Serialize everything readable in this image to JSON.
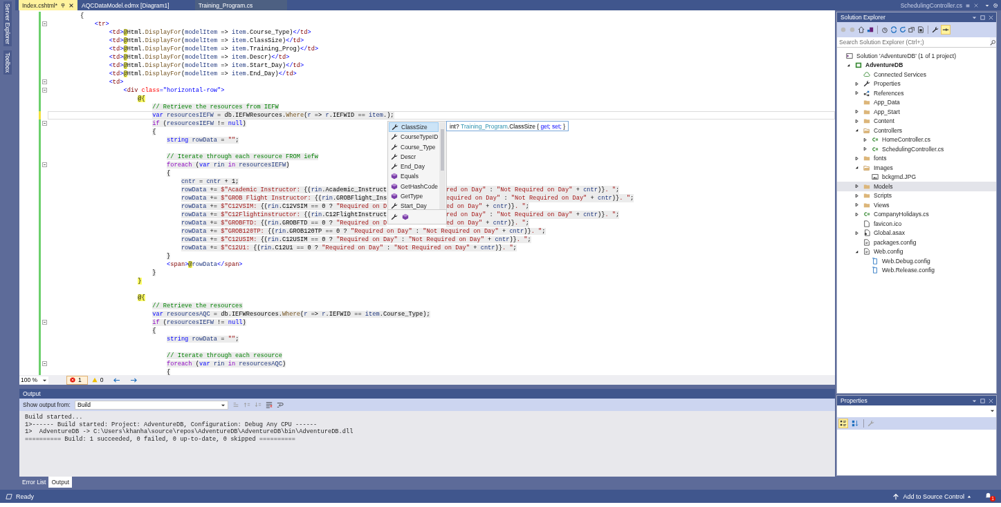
{
  "side_tabs": [
    "Server Explorer",
    "Toolbox"
  ],
  "tabs": [
    {
      "label": "Index.cshtml*",
      "selected": true
    },
    {
      "label": "AQCDataModel.edmx [Diagram1]",
      "selected": false
    },
    {
      "label": "Training_Program.cs",
      "selected": false
    }
  ],
  "preview_tab": {
    "label": "SchedulingController.cs"
  },
  "editor": {
    "lines": [
      {
        "tokens": [
          {
            "kind": "plain",
            "text": "        {"
          }
        ],
        "shaded": false,
        "fold": false,
        "current": false
      },
      {
        "tokens": [
          {
            "kind": "bracket",
            "text": "            <"
          },
          {
            "kind": "tag",
            "text": "tr"
          },
          {
            "kind": "bracket",
            "text": ">"
          }
        ],
        "shaded": false,
        "fold": true,
        "current": false
      },
      {
        "tokens": [
          {
            "kind": "bracket",
            "text": "                <"
          },
          {
            "kind": "tag",
            "text": "td"
          },
          {
            "kind": "bracket",
            "text": ">"
          },
          {
            "kind": "razor",
            "text": "@"
          },
          {
            "kind": "plain",
            "text": "Html."
          },
          {
            "kind": "method",
            "text": "DisplayFor"
          },
          {
            "kind": "plain",
            "text": "("
          },
          {
            "kind": "local",
            "text": "modelItem"
          },
          {
            "kind": "plain",
            "text": " => "
          },
          {
            "kind": "local",
            "text": "item"
          },
          {
            "kind": "plain",
            "text": ".Course_Type)"
          },
          {
            "kind": "bracket",
            "text": "</"
          },
          {
            "kind": "tag",
            "text": "td"
          },
          {
            "kind": "bracket",
            "text": ">"
          }
        ],
        "shaded": false,
        "fold": false,
        "current": false
      },
      {
        "tokens": [
          {
            "kind": "bracket",
            "text": "                <"
          },
          {
            "kind": "tag",
            "text": "td"
          },
          {
            "kind": "bracket",
            "text": ">"
          },
          {
            "kind": "razor",
            "text": "@"
          },
          {
            "kind": "plain",
            "text": "Html."
          },
          {
            "kind": "method",
            "text": "DisplayFor"
          },
          {
            "kind": "plain",
            "text": "("
          },
          {
            "kind": "local",
            "text": "modelItem"
          },
          {
            "kind": "plain",
            "text": " => "
          },
          {
            "kind": "local",
            "text": "item"
          },
          {
            "kind": "plain",
            "text": ".ClassSize)"
          },
          {
            "kind": "bracket",
            "text": "</"
          },
          {
            "kind": "tag",
            "text": "td"
          },
          {
            "kind": "bracket",
            "text": ">"
          }
        ],
        "shaded": false,
        "fold": false,
        "current": false
      },
      {
        "tokens": [
          {
            "kind": "bracket",
            "text": "                <"
          },
          {
            "kind": "tag",
            "text": "td"
          },
          {
            "kind": "bracket",
            "text": ">"
          },
          {
            "kind": "razor",
            "text": "@"
          },
          {
            "kind": "plain",
            "text": "Html."
          },
          {
            "kind": "method",
            "text": "DisplayFor"
          },
          {
            "kind": "plain",
            "text": "("
          },
          {
            "kind": "local",
            "text": "modelItem"
          },
          {
            "kind": "plain",
            "text": " => "
          },
          {
            "kind": "local",
            "text": "item"
          },
          {
            "kind": "plain",
            "text": ".Training_Prog)"
          },
          {
            "kind": "bracket",
            "text": "</"
          },
          {
            "kind": "tag",
            "text": "td"
          },
          {
            "kind": "bracket",
            "text": ">"
          }
        ],
        "shaded": false,
        "fold": false,
        "current": false
      },
      {
        "tokens": [
          {
            "kind": "bracket",
            "text": "                <"
          },
          {
            "kind": "tag",
            "text": "td"
          },
          {
            "kind": "bracket",
            "text": ">"
          },
          {
            "kind": "razor",
            "text": "@"
          },
          {
            "kind": "plain",
            "text": "Html."
          },
          {
            "kind": "method",
            "text": "DisplayFor"
          },
          {
            "kind": "plain",
            "text": "("
          },
          {
            "kind": "local",
            "text": "modelItem"
          },
          {
            "kind": "plain",
            "text": " => "
          },
          {
            "kind": "local",
            "text": "item"
          },
          {
            "kind": "plain",
            "text": ".Descr)"
          },
          {
            "kind": "bracket",
            "text": "</"
          },
          {
            "kind": "tag",
            "text": "td"
          },
          {
            "kind": "bracket",
            "text": ">"
          }
        ],
        "shaded": false,
        "fold": false,
        "current": false
      },
      {
        "tokens": [
          {
            "kind": "bracket",
            "text": "                <"
          },
          {
            "kind": "tag",
            "text": "td"
          },
          {
            "kind": "bracket",
            "text": ">"
          },
          {
            "kind": "razor",
            "text": "@"
          },
          {
            "kind": "plain",
            "text": "Html."
          },
          {
            "kind": "method",
            "text": "DisplayFor"
          },
          {
            "kind": "plain",
            "text": "("
          },
          {
            "kind": "local",
            "text": "modelItem"
          },
          {
            "kind": "plain",
            "text": " => "
          },
          {
            "kind": "local",
            "text": "item"
          },
          {
            "kind": "plain",
            "text": ".Start_Day)"
          },
          {
            "kind": "bracket",
            "text": "</"
          },
          {
            "kind": "tag",
            "text": "td"
          },
          {
            "kind": "bracket",
            "text": ">"
          }
        ],
        "shaded": false,
        "fold": false,
        "current": false
      },
      {
        "tokens": [
          {
            "kind": "bracket",
            "text": "                <"
          },
          {
            "kind": "tag",
            "text": "td"
          },
          {
            "kind": "bracket",
            "text": ">"
          },
          {
            "kind": "razor",
            "text": "@"
          },
          {
            "kind": "plain",
            "text": "Html."
          },
          {
            "kind": "method",
            "text": "DisplayFor"
          },
          {
            "kind": "plain",
            "text": "("
          },
          {
            "kind": "local",
            "text": "modelItem"
          },
          {
            "kind": "plain",
            "text": " => "
          },
          {
            "kind": "local",
            "text": "item"
          },
          {
            "kind": "plain",
            "text": ".End_Day)"
          },
          {
            "kind": "bracket",
            "text": "</"
          },
          {
            "kind": "tag",
            "text": "td"
          },
          {
            "kind": "bracket",
            "text": ">"
          }
        ],
        "shaded": false,
        "fold": false,
        "current": false
      },
      {
        "tokens": [
          {
            "kind": "bracket",
            "text": "                <"
          },
          {
            "kind": "tag",
            "text": "td"
          },
          {
            "kind": "bracket",
            "text": ">"
          }
        ],
        "shaded": false,
        "fold": true,
        "current": false
      },
      {
        "tokens": [
          {
            "kind": "bracket",
            "text": "                    <"
          },
          {
            "kind": "tag",
            "text": "div"
          },
          {
            "kind": "attr",
            "text": " class"
          },
          {
            "kind": "bracket",
            "text": "=\"horizontal-row\">"
          }
        ],
        "shaded": false,
        "fold": true,
        "current": false
      },
      {
        "tokens": [
          {
            "kind": "razor",
            "text": "                        @{"
          }
        ],
        "shaded": false,
        "fold": false,
        "current": false
      },
      {
        "tokens": [
          {
            "kind": "comment",
            "text": "                            // Retrieve the resources from IEFW"
          }
        ],
        "shaded": true,
        "fold": false,
        "current": false
      },
      {
        "tokens": [
          {
            "kind": "keyword",
            "text": "                            var"
          },
          {
            "kind": "local",
            "text": " resourcesIEFW"
          },
          {
            "kind": "plain",
            "text": " = db.IEFWResources."
          },
          {
            "kind": "method",
            "text": "Where"
          },
          {
            "kind": "plain",
            "text": "("
          },
          {
            "kind": "local",
            "text": "r"
          },
          {
            "kind": "plain",
            "text": " => "
          },
          {
            "kind": "local",
            "text": "r"
          },
          {
            "kind": "plain",
            "text": ".IEFWID == "
          },
          {
            "kind": "local",
            "text": "item"
          },
          {
            "kind": "plain",
            "text": ".);"
          }
        ],
        "shaded": true,
        "fold": false,
        "current": true
      },
      {
        "tokens": [
          {
            "kind": "control",
            "text": "                            if"
          },
          {
            "kind": "plain",
            "text": " ("
          },
          {
            "kind": "local",
            "text": "resourcesIEFW"
          },
          {
            "kind": "plain",
            "text": " != "
          },
          {
            "kind": "keyword",
            "text": "null"
          },
          {
            "kind": "plain",
            "text": ")"
          }
        ],
        "shaded": true,
        "fold": true,
        "current": false
      },
      {
        "tokens": [
          {
            "kind": "plain",
            "text": "                            {"
          }
        ],
        "shaded": true,
        "fold": false,
        "current": false
      },
      {
        "tokens": [
          {
            "kind": "keyword",
            "text": "                                string"
          },
          {
            "kind": "local",
            "text": " rowData"
          },
          {
            "kind": "plain",
            "text": " = "
          },
          {
            "kind": "string",
            "text": "\"\""
          },
          {
            "kind": "plain",
            "text": ";"
          }
        ],
        "shaded": true,
        "fold": false,
        "current": false
      },
      {
        "fold": false,
        "current": false
      },
      {
        "tokens": [
          {
            "kind": "comment",
            "text": "                                // Iterate through each resource FROM iefw"
          }
        ],
        "shaded": true,
        "fold": false,
        "current": false
      },
      {
        "tokens": [
          {
            "kind": "control",
            "text": "                                foreach"
          },
          {
            "kind": "plain",
            "text": " ("
          },
          {
            "kind": "keyword",
            "text": "var"
          },
          {
            "kind": "local",
            "text": " rin"
          },
          {
            "kind": "control",
            "text": " in"
          },
          {
            "kind": "local",
            "text": " resourcesIEFW"
          },
          {
            "kind": "plain",
            "text": ")"
          }
        ],
        "shaded": true,
        "fold": true,
        "current": false
      },
      {
        "tokens": [
          {
            "kind": "plain",
            "text": "                                {"
          }
        ],
        "shaded": true,
        "fold": false,
        "current": false
      },
      {
        "tokens": [
          {
            "kind": "local",
            "text": "                                    cntr"
          },
          {
            "kind": "plain",
            "text": " = "
          },
          {
            "kind": "local",
            "text": "cntr"
          },
          {
            "kind": "plain",
            "text": " + 1;"
          }
        ],
        "shaded": true,
        "fold": false,
        "current": false
      },
      {
        "tokens": [
          {
            "kind": "local",
            "text": "                                    rowData"
          },
          {
            "kind": "plain",
            "text": " += "
          },
          {
            "kind": "string",
            "text": "$\"Academic Instructor: "
          },
          {
            "kind": "plain",
            "text": "{("
          },
          {
            "kind": "local",
            "text": "rin"
          },
          {
            "kind": "plain",
            "text": ".Academic_Instruct"
          }
        ],
        "tokens_after": [
          {
            "kind": "string",
            "text": "red on Day\""
          },
          {
            "kind": "plain",
            "text": " : "
          },
          {
            "kind": "string",
            "text": "\"Not Required on Day\""
          },
          {
            "kind": "plain",
            "text": " + "
          },
          {
            "kind": "local",
            "text": "cntr"
          },
          {
            "kind": "plain",
            "text": ")}"
          },
          {
            "kind": "string",
            "text": ". \""
          },
          {
            "kind": "plain",
            "text": ";"
          }
        ],
        "shaded": true,
        "fold": false,
        "current": false
      },
      {
        "tokens": [
          {
            "kind": "local",
            "text": "                                    rowData"
          },
          {
            "kind": "plain",
            "text": " += "
          },
          {
            "kind": "string",
            "text": "$\"GROB Flight Instructor: "
          },
          {
            "kind": "plain",
            "text": "{("
          },
          {
            "kind": "local",
            "text": "rin"
          },
          {
            "kind": "plain",
            "text": ".GROBFlight_Ins"
          }
        ],
        "tokens_after": [
          {
            "kind": "string",
            "text": "equired on Day\""
          },
          {
            "kind": "plain",
            "text": " : "
          },
          {
            "kind": "string",
            "text": "\"Not Required on Day\""
          },
          {
            "kind": "plain",
            "text": " + "
          },
          {
            "kind": "local",
            "text": "cntr"
          },
          {
            "kind": "plain",
            "text": ")}"
          },
          {
            "kind": "string",
            "text": ". \""
          },
          {
            "kind": "plain",
            "text": ";"
          }
        ],
        "shaded": true,
        "fold": false,
        "current": false
      },
      {
        "tokens": [
          {
            "kind": "local",
            "text": "                                    rowData"
          },
          {
            "kind": "plain",
            "text": " += "
          },
          {
            "kind": "string",
            "text": "$\"C12VSIM: "
          },
          {
            "kind": "plain",
            "text": "{("
          },
          {
            "kind": "local",
            "text": "rin"
          },
          {
            "kind": "plain",
            "text": ".C12VSIM == 0 ? "
          },
          {
            "kind": "string",
            "text": "\"Required on D"
          }
        ],
        "tokens_after": [
          {
            "kind": "string",
            "text": "ed on Day\""
          },
          {
            "kind": "plain",
            "text": " + "
          },
          {
            "kind": "local",
            "text": "cntr"
          },
          {
            "kind": "plain",
            "text": ")}"
          },
          {
            "kind": "string",
            "text": ". \""
          },
          {
            "kind": "plain",
            "text": ";"
          }
        ],
        "shaded": true,
        "fold": false,
        "current": false
      },
      {
        "tokens": [
          {
            "kind": "local",
            "text": "                                    rowData"
          },
          {
            "kind": "plain",
            "text": " += "
          },
          {
            "kind": "string",
            "text": "$\"C12Flightinstructor: "
          },
          {
            "kind": "plain",
            "text": "{("
          },
          {
            "kind": "local",
            "text": "rin"
          },
          {
            "kind": "plain",
            "text": ".C12FlightInstruct"
          }
        ],
        "tokens_after": [
          {
            "kind": "string",
            "text": "red on Day\""
          },
          {
            "kind": "plain",
            "text": " : "
          },
          {
            "kind": "string",
            "text": "\"Not Required on Day\""
          },
          {
            "kind": "plain",
            "text": " + "
          },
          {
            "kind": "local",
            "text": "cntr"
          },
          {
            "kind": "plain",
            "text": ")}"
          },
          {
            "kind": "string",
            "text": ". \""
          },
          {
            "kind": "plain",
            "text": ";"
          }
        ],
        "shaded": true,
        "fold": false,
        "current": false
      },
      {
        "tokens": [
          {
            "kind": "local",
            "text": "                                    rowData"
          },
          {
            "kind": "plain",
            "text": " += "
          },
          {
            "kind": "string",
            "text": "$\"GROBFTD: "
          },
          {
            "kind": "plain",
            "text": "{("
          },
          {
            "kind": "local",
            "text": "rin"
          },
          {
            "kind": "plain",
            "text": ".GROBFTD == 0 ? "
          },
          {
            "kind": "string",
            "text": "\"Required on D"
          }
        ],
        "tokens_after": [
          {
            "kind": "string",
            "text": "ed on Day\""
          },
          {
            "kind": "plain",
            "text": " + "
          },
          {
            "kind": "local",
            "text": "cntr"
          },
          {
            "kind": "plain",
            "text": ")}"
          },
          {
            "kind": "string",
            "text": ". \""
          },
          {
            "kind": "plain",
            "text": ";"
          }
        ],
        "shaded": true,
        "fold": false,
        "current": false
      },
      {
        "tokens": [
          {
            "kind": "local",
            "text": "                                    rowData"
          },
          {
            "kind": "plain",
            "text": " += "
          },
          {
            "kind": "string",
            "text": "$\"GROB120TP: "
          },
          {
            "kind": "plain",
            "text": "{("
          },
          {
            "kind": "local",
            "text": "rin"
          },
          {
            "kind": "plain",
            "text": ".GROB120TP == 0 ? "
          },
          {
            "kind": "string",
            "text": "\"Required on Day\""
          },
          {
            "kind": "plain",
            "text": " : "
          },
          {
            "kind": "string",
            "text": "\"Not Required on Day\""
          },
          {
            "kind": "plain",
            "text": " + "
          },
          {
            "kind": "local",
            "text": "cntr"
          },
          {
            "kind": "plain",
            "text": ")}"
          },
          {
            "kind": "string",
            "text": ". \""
          },
          {
            "kind": "plain",
            "text": ";"
          }
        ],
        "shaded": true,
        "fold": false,
        "current": false
      },
      {
        "tokens": [
          {
            "kind": "local",
            "text": "                                    rowData"
          },
          {
            "kind": "plain",
            "text": " += "
          },
          {
            "kind": "string",
            "text": "$\"C12USIM: "
          },
          {
            "kind": "plain",
            "text": "{("
          },
          {
            "kind": "local",
            "text": "rin"
          },
          {
            "kind": "plain",
            "text": ".C12USIM == 0 ? "
          },
          {
            "kind": "string",
            "text": "\"Required on Day\""
          },
          {
            "kind": "plain",
            "text": " : "
          },
          {
            "kind": "string",
            "text": "\"Not Required on Day\""
          },
          {
            "kind": "plain",
            "text": " + "
          },
          {
            "kind": "local",
            "text": "cntr"
          },
          {
            "kind": "plain",
            "text": ")}"
          },
          {
            "kind": "string",
            "text": ". \""
          },
          {
            "kind": "plain",
            "text": ";"
          }
        ],
        "shaded": true,
        "fold": false,
        "current": false
      },
      {
        "tokens": [
          {
            "kind": "local",
            "text": "                                    rowData"
          },
          {
            "kind": "plain",
            "text": " += "
          },
          {
            "kind": "string",
            "text": "$\"C12U1: "
          },
          {
            "kind": "plain",
            "text": "{("
          },
          {
            "kind": "local",
            "text": "rin"
          },
          {
            "kind": "plain",
            "text": ".C12U1 == 0 ? "
          },
          {
            "kind": "string",
            "text": "\"Required on Day\""
          },
          {
            "kind": "plain",
            "text": " : "
          },
          {
            "kind": "string",
            "text": "\"Not Required on Day\""
          },
          {
            "kind": "plain",
            "text": " + "
          },
          {
            "kind": "local",
            "text": "cntr"
          },
          {
            "kind": "plain",
            "text": ")}"
          },
          {
            "kind": "string",
            "text": ". \""
          },
          {
            "kind": "plain",
            "text": ";"
          }
        ],
        "shaded": true,
        "fold": false,
        "current": false
      },
      {
        "tokens": [
          {
            "kind": "plain",
            "text": "                                }"
          }
        ],
        "shaded": true,
        "fold": false,
        "current": false
      },
      {
        "tokens": [
          {
            "kind": "bracket",
            "text": "                                <"
          },
          {
            "kind": "tag",
            "text": "span"
          },
          {
            "kind": "bracket",
            "text": ">"
          },
          {
            "kind": "razor",
            "text": "@"
          },
          {
            "kind": "local",
            "text": "rowData"
          },
          {
            "kind": "bracket",
            "text": "</"
          },
          {
            "kind": "tag",
            "text": "span"
          },
          {
            "kind": "bracket",
            "text": ">"
          }
        ],
        "shaded": false,
        "fold": false,
        "current": false
      },
      {
        "tokens": [
          {
            "kind": "plain",
            "text": "                            }"
          }
        ],
        "shaded": true,
        "fold": false,
        "current": false
      },
      {
        "tokens": [
          {
            "kind": "razor",
            "text": "                        }"
          }
        ],
        "shaded": false,
        "fold": false,
        "current": false
      },
      {
        "fold": false,
        "current": false
      },
      {
        "tokens": [
          {
            "kind": "razor",
            "text": "                        @{"
          }
        ],
        "shaded": false,
        "fold": false,
        "current": false
      },
      {
        "tokens": [
          {
            "kind": "comment",
            "text": "                            // Retrieve the resources"
          }
        ],
        "shaded": true,
        "fold": false,
        "current": false
      },
      {
        "tokens": [
          {
            "kind": "keyword",
            "text": "                            var"
          },
          {
            "kind": "local",
            "text": " resourcesAQC"
          },
          {
            "kind": "plain",
            "text": " = db.IEFWResources."
          },
          {
            "kind": "method",
            "text": "Where"
          },
          {
            "kind": "plain",
            "text": "("
          },
          {
            "kind": "local",
            "text": "r"
          },
          {
            "kind": "plain",
            "text": " => "
          },
          {
            "kind": "local",
            "text": "r"
          },
          {
            "kind": "plain",
            "text": ".IEFWID == "
          },
          {
            "kind": "local",
            "text": "item"
          },
          {
            "kind": "plain",
            "text": ".Course_Type);"
          }
        ],
        "shaded": true,
        "fold": false,
        "current": false
      },
      {
        "tokens": [
          {
            "kind": "control",
            "text": "                            if"
          },
          {
            "kind": "plain",
            "text": " ("
          },
          {
            "kind": "local",
            "text": "resourcesIEFW"
          },
          {
            "kind": "plain",
            "text": " != "
          },
          {
            "kind": "keyword",
            "text": "null"
          },
          {
            "kind": "plain",
            "text": ")"
          }
        ],
        "shaded": true,
        "fold": true,
        "current": false
      },
      {
        "tokens": [
          {
            "kind": "plain",
            "text": "                            {"
          }
        ],
        "shaded": true,
        "fold": false,
        "current": false
      },
      {
        "tokens": [
          {
            "kind": "keyword",
            "text": "                                string"
          },
          {
            "kind": "local",
            "text": " rowData"
          },
          {
            "kind": "plain",
            "text": " = "
          },
          {
            "kind": "string",
            "text": "\"\""
          },
          {
            "kind": "plain",
            "text": ";"
          }
        ],
        "shaded": true,
        "fold": false,
        "current": false
      },
      {
        "fold": false,
        "current": false
      },
      {
        "tokens": [
          {
            "kind": "comment",
            "text": "                                // Iterate through each resource"
          }
        ],
        "shaded": true,
        "fold": false,
        "current": false
      },
      {
        "tokens": [
          {
            "kind": "control",
            "text": "                                foreach"
          },
          {
            "kind": "plain",
            "text": " ("
          },
          {
            "kind": "keyword",
            "text": "var"
          },
          {
            "kind": "local",
            "text": " rin"
          },
          {
            "kind": "control",
            "text": " in"
          },
          {
            "kind": "local",
            "text": " resourcesAQC"
          },
          {
            "kind": "plain",
            "text": ")"
          }
        ],
        "shaded": true,
        "fold": true,
        "current": false
      },
      {
        "tokens": [
          {
            "kind": "plain",
            "text": "                                {"
          }
        ],
        "shaded": true,
        "fold": false,
        "current": false
      }
    ],
    "completion": {
      "items": [
        {
          "label": "ClassSize",
          "kind": "property",
          "selected": true
        },
        {
          "label": "CourseTypeID",
          "kind": "property",
          "selected": false
        },
        {
          "label": "Course_Type",
          "kind": "property",
          "selected": false
        },
        {
          "label": "Descr",
          "kind": "property",
          "selected": false
        },
        {
          "label": "End_Day",
          "kind": "property",
          "selected": false
        },
        {
          "label": "Equals",
          "kind": "method",
          "selected": false
        },
        {
          "label": "GetHashCode",
          "kind": "method",
          "selected": false
        },
        {
          "label": "GetType",
          "kind": "method",
          "selected": false
        },
        {
          "label": "Start_Day",
          "kind": "property",
          "selected": false
        }
      ],
      "tooltip": [
        {
          "kind": "plain",
          "text": "int? "
        },
        {
          "kind": "type",
          "text": "Training_Program"
        },
        {
          "kind": "plain",
          "text": ".ClassSize { "
        },
        {
          "kind": "keyword",
          "text": "get; set;"
        },
        {
          "kind": "plain",
          "text": " }"
        }
      ]
    },
    "zoom": "100 %",
    "errors": "1",
    "warnings": "0"
  },
  "output": {
    "title": "Output",
    "source_label": "Show output from:",
    "source": "Build",
    "lines": [
      "Build started...",
      "1>------ Build started: Project: AdventureDB, Configuration: Debug Any CPU ------",
      "1>  AdventureDB -> C:\\Users\\khanha\\source\\repos\\AdventureDB\\AdventureDB\\bin\\AdventureDB.dll",
      "========== Build: 1 succeeded, 0 failed, 0 up-to-date, 0 skipped =========="
    ]
  },
  "bottom_tabs": [
    {
      "label": "Error List",
      "selected": false
    },
    {
      "label": "Output",
      "selected": true
    }
  ],
  "solution_explorer": {
    "title": "Solution Explorer",
    "search_placeholder": "Search Solution Explorer (Ctrl+;)",
    "preview_on": true,
    "tree": [
      {
        "label": "Solution 'AdventureDB' (1 of 1 project)",
        "kind": "solution",
        "selected": false,
        "children": [
          {
            "label": "AdventureDB",
            "kind": "project",
            "expanded": true,
            "selected": false,
            "children": [
              {
                "label": "Connected Services",
                "kind": "service",
                "selected": false
              },
              {
                "label": "Properties",
                "kind": "properties",
                "expanded": false,
                "selected": false
              },
              {
                "label": "References",
                "kind": "references",
                "expanded": false,
                "selected": false
              },
              {
                "label": "App_Data",
                "kind": "folder",
                "selected": false
              },
              {
                "label": "App_Start",
                "kind": "folder",
                "expanded": false,
                "selected": false
              },
              {
                "label": "Content",
                "kind": "folder",
                "expanded": false,
                "selected": false
              },
              {
                "label": "Controllers",
                "kind": "folder",
                "expanded": true,
                "selected": false,
                "children": [
                  {
                    "label": "HomeController.cs",
                    "kind": "cs",
                    "expanded": false,
                    "selected": false
                  },
                  {
                    "label": "SchedulingController.cs",
                    "kind": "cs",
                    "expanded": false,
                    "selected": false
                  }
                ]
              },
              {
                "label": "fonts",
                "kind": "folder",
                "expanded": false,
                "selected": false
              },
              {
                "label": "Images",
                "kind": "folder",
                "expanded": true,
                "selected": false,
                "children": [
                  {
                    "label": "bckgrnd.JPG",
                    "kind": "image",
                    "selected": false
                  }
                ]
              },
              {
                "label": "Models",
                "kind": "folder",
                "expanded": false,
                "selected": true
              },
              {
                "label": "Scripts",
                "kind": "folder",
                "expanded": false,
                "selected": false
              },
              {
                "label": "Views",
                "kind": "folder",
                "expanded": false,
                "selected": false
              },
              {
                "label": "CompanyHolidays.cs",
                "kind": "cs",
                "expanded": false,
                "selected": false
              },
              {
                "label": "favicon.ico",
                "kind": "file",
                "selected": false
              },
              {
                "label": "Global.asax",
                "kind": "asax",
                "expanded": false,
                "selected": false
              },
              {
                "label": "packages.config",
                "kind": "config",
                "selected": false
              },
              {
                "label": "Web.config",
                "kind": "config",
                "expanded": true,
                "selected": false,
                "children": [
                  {
                    "label": "Web.Debug.config",
                    "kind": "transform",
                    "selected": false
                  },
                  {
                    "label": "Web.Release.config",
                    "kind": "transform",
                    "selected": false
                  }
                ]
              }
            ]
          }
        ]
      }
    ]
  },
  "properties": {
    "title": "Properties",
    "categorized": true,
    "alphabetical": false
  },
  "status_bar": {
    "text": "Ready",
    "source_control": "Add to Source Control",
    "notifications": "1"
  }
}
